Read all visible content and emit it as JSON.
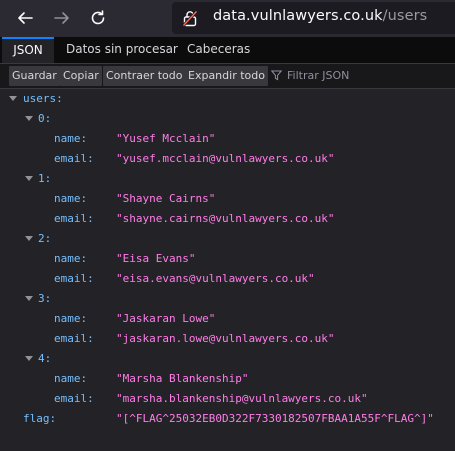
{
  "browser": {
    "url_host": "data.vulnlawyers.co.uk",
    "url_path": "/users",
    "back_icon": "arrow-left-icon",
    "forward_icon": "arrow-right-icon",
    "reload_icon": "reload-icon",
    "security_icon": "insecure-lock-icon"
  },
  "viewer": {
    "tabs": [
      {
        "label": "JSON",
        "active": true
      },
      {
        "label": "Datos sin procesar",
        "active": false
      },
      {
        "label": "Cabeceras",
        "active": false
      }
    ],
    "actions": {
      "save": "Guardar",
      "copy": "Copiar",
      "collapse_all": "Contraer todo",
      "expand_all": "Expandir todo"
    },
    "filter_placeholder": "Filtrar JSON"
  },
  "json": {
    "root_key": "users:",
    "users": [
      {
        "index": "0:",
        "name_key": "name:",
        "name": "\"Yusef Mcclain\"",
        "email_key": "email:",
        "email": "\"yusef.mcclain@vulnlawyers.co.uk\""
      },
      {
        "index": "1:",
        "name_key": "name:",
        "name": "\"Shayne Cairns\"",
        "email_key": "email:",
        "email": "\"shayne.cairns@vulnlawyers.co.uk\""
      },
      {
        "index": "2:",
        "name_key": "name:",
        "name": "\"Eisa Evans\"",
        "email_key": "email:",
        "email": "\"eisa.evans@vulnlawyers.co.uk\""
      },
      {
        "index": "3:",
        "name_key": "name:",
        "name": "\"Jaskaran Lowe\"",
        "email_key": "email:",
        "email": "\"jaskaran.lowe@vulnlawyers.co.uk\""
      },
      {
        "index": "4:",
        "name_key": "name:",
        "name": "\"Marsha Blankenship\"",
        "email_key": "email:",
        "email": "\"marsha.blankenship@vulnlawyers.co.uk\""
      }
    ],
    "flag_key": "flag:",
    "flag": "\"[^FLAG^25032EB0D322F7330182507FBAA1A55F^FLAG^]\""
  },
  "colors": {
    "key": "#75bfff",
    "string": "#ff7de9",
    "accent": "#0a84ff"
  }
}
